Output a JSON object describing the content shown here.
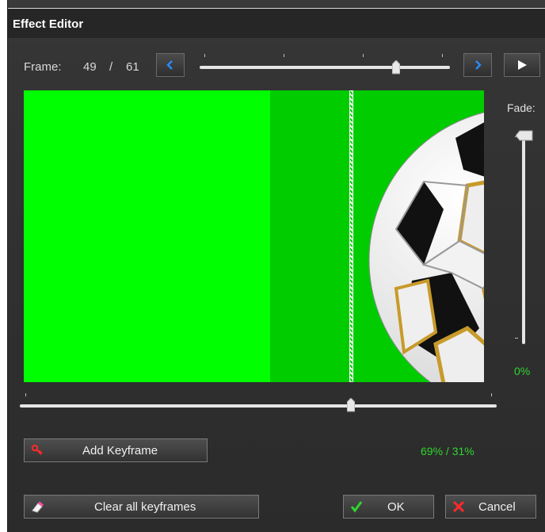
{
  "window": {
    "title": "Effect Editor"
  },
  "frame": {
    "label": "Frame:",
    "current": "49",
    "separator": "/",
    "total": "61"
  },
  "nav": {
    "prev_icon": "chevron-left-icon",
    "next_icon": "chevron-right-icon",
    "play_icon": "play-icon"
  },
  "frame_slider": {
    "value": 49,
    "max": 61
  },
  "preview": {
    "green_color": "#00ff00",
    "shade_color": "#00cc00",
    "content": "soccer-ball"
  },
  "transition_slider": {
    "position_percent": 69
  },
  "fade": {
    "label": "Fade:",
    "value": "0%",
    "value_color": "#2fd52f"
  },
  "buttons": {
    "add_keyframe": "Add Keyframe",
    "clear_keyframes": "Clear all keyframes",
    "ok": "OK",
    "cancel": "Cancel"
  },
  "ratio": "69% / 31%"
}
